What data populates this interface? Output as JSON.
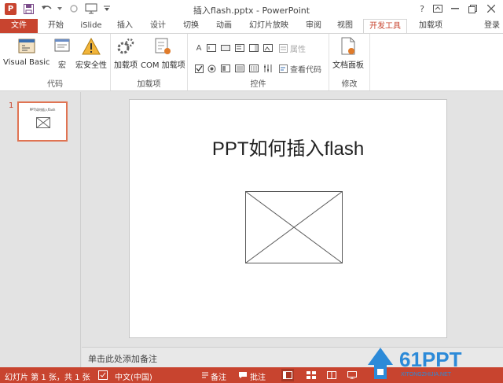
{
  "window": {
    "title": "插入flash.pptx - PowerPoint",
    "app_logo": "P",
    "help": "?",
    "login": "登录"
  },
  "tabs": [
    {
      "label": "文件"
    },
    {
      "label": "开始"
    },
    {
      "label": "iSlide"
    },
    {
      "label": "插入"
    },
    {
      "label": "设计"
    },
    {
      "label": "切换"
    },
    {
      "label": "动画"
    },
    {
      "label": "幻灯片放映"
    },
    {
      "label": "审阅"
    },
    {
      "label": "视图"
    },
    {
      "label": "开发工具"
    },
    {
      "label": "加载项"
    }
  ],
  "ribbon": {
    "code_group": {
      "label": "代码",
      "visual_basic": "Visual Basic",
      "macros": "宏",
      "macro_security": "宏安全性"
    },
    "addins_group": {
      "label": "加载项",
      "addins": "加载项",
      "com_addins": "COM 加载项"
    },
    "controls_group": {
      "label": "控件",
      "properties": "属性",
      "view_code": "查看代码",
      "label_glyph": "A"
    },
    "modify_group": {
      "label": "修改",
      "document_panel": "文档面板"
    }
  },
  "slide": {
    "number": "1",
    "title": "PPT如何插入flash",
    "thumb_title": "PPT如何插入flash"
  },
  "notes": {
    "placeholder": "单击此处添加备注"
  },
  "status": {
    "slide_info": "幻灯片 第 1 张，共 1 张",
    "language": "中文(中国)",
    "notes": "备注",
    "comments": "批注"
  },
  "watermark": {
    "brand": "61PPT",
    "sub": "XITONGZHIJIA.NET"
  },
  "colors": {
    "accent": "#c8442f"
  }
}
